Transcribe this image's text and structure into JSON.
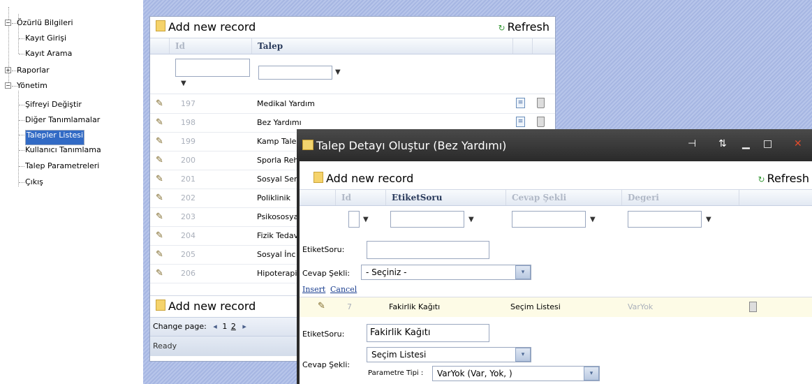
{
  "tree": {
    "root1": "Özürlü Bilgileri",
    "root1_children": [
      "Kayıt Girişi",
      "Kayıt Arama"
    ],
    "root2": "Raporlar",
    "root3": "Yönetim",
    "root3_children": [
      "Şifreyi Değiştir",
      "Diğer Tanımlamalar",
      "Talepler Listesi",
      "Kullanıcı Tanımlama",
      "Talep Parametreleri",
      "Çıkış"
    ],
    "selected": "Talepler Listesi",
    "expanded_symbol": "−",
    "collapsed_symbol": "+"
  },
  "grid1": {
    "add_label": "Add new record",
    "refresh_label": "Refresh",
    "col_id": "Id",
    "col_talep": "Talep",
    "rows": [
      {
        "id": "197",
        "talep": "Medikal Yardım"
      },
      {
        "id": "198",
        "talep": "Bez Yardımı"
      },
      {
        "id": "199",
        "talep": "Kamp Talep"
      },
      {
        "id": "200",
        "talep": "Sporla Reh"
      },
      {
        "id": "201",
        "talep": "Sosyal Ser"
      },
      {
        "id": "202",
        "talep": "Poliklinik"
      },
      {
        "id": "203",
        "talep": "Psikososya"
      },
      {
        "id": "204",
        "talep": "Fizik Tedav"
      },
      {
        "id": "205",
        "talep": "Sosyal İnc"
      },
      {
        "id": "206",
        "talep": "Hipoterapi"
      }
    ],
    "pager_label": "Change page:",
    "pager_pages": [
      "1",
      "2"
    ],
    "status": "Ready"
  },
  "window": {
    "title": "Talep Detayı Oluştur (Bez Yardımı)",
    "add_label": "Add new record",
    "refresh_label": "Refresh",
    "col_id": "Id",
    "col_etiket": "EtiketSoru",
    "col_cevap": "Cevap Şekli",
    "col_degeri": "Degeri",
    "insert_form": {
      "etiket_label": "EtiketSoru:",
      "etiket_value": "",
      "cevap_label": "Cevap Şekli:",
      "cevap_value": "- Seçiniz -",
      "insert_link": "Insert",
      "cancel_link": "Cancel"
    },
    "row": {
      "id": "7",
      "etiket": "Fakirlik Kağıtı",
      "cevap": "Seçim Listesi",
      "degeri": "VarYok"
    },
    "edit_form": {
      "etiket_label": "EtiketSoru:",
      "etiket_value": "Fakirlik Kağıtı",
      "cevap_label": "Cevap Şekli:",
      "cevap_value": "Seçim Listesi",
      "param_label": "Parametre Tipi :",
      "param_value": "VarYok (Var, Yok, )"
    }
  }
}
